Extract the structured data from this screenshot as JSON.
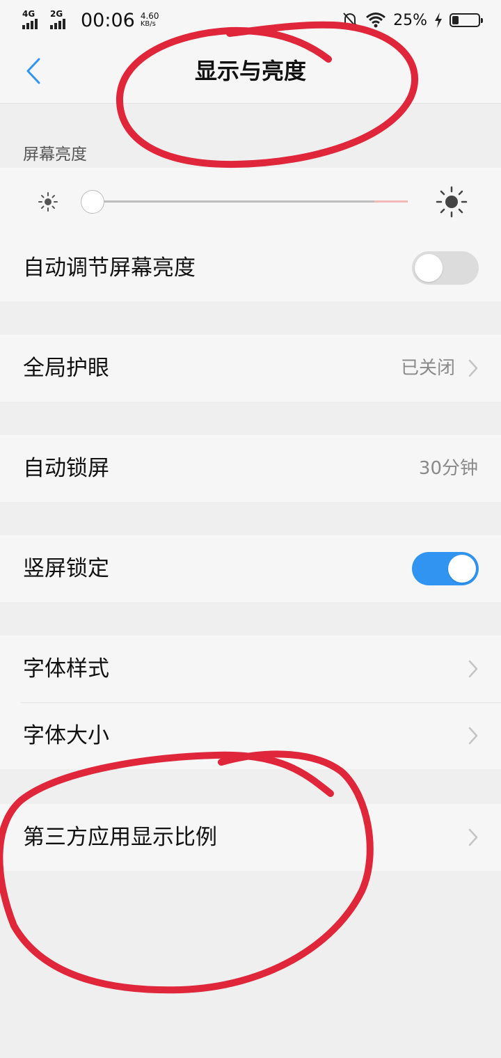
{
  "status_bar": {
    "network1": "4G",
    "network2": "2G",
    "time": "00:06",
    "speed_value": "4.60",
    "speed_unit": "KB/s",
    "battery_text": "25%",
    "battery_level": 0.25,
    "icons": [
      "signal-icon",
      "bell-off-icon",
      "wifi-icon",
      "charging-icon",
      "battery-icon"
    ]
  },
  "nav": {
    "back_icon": "chevron-left-icon",
    "title": "显示与亮度"
  },
  "brightness": {
    "section_label": "屏幕亮度",
    "level": 0.0
  },
  "auto_brightness": {
    "label": "自动调节屏幕亮度",
    "enabled": false
  },
  "eye_protection": {
    "label": "全局护眼",
    "value": "已关闭"
  },
  "auto_lock": {
    "label": "自动锁屏",
    "value": "30分钟"
  },
  "portrait_lock": {
    "label": "竖屏锁定",
    "enabled": true
  },
  "font_style": {
    "label": "字体样式"
  },
  "font_size": {
    "label": "字体大小"
  },
  "app_ratio": {
    "label": "第三方应用显示比例"
  },
  "colors": {
    "accent": "#3094f0",
    "annotation": "#e0263a",
    "background": "#efefef",
    "panel": "#f6f6f6"
  }
}
